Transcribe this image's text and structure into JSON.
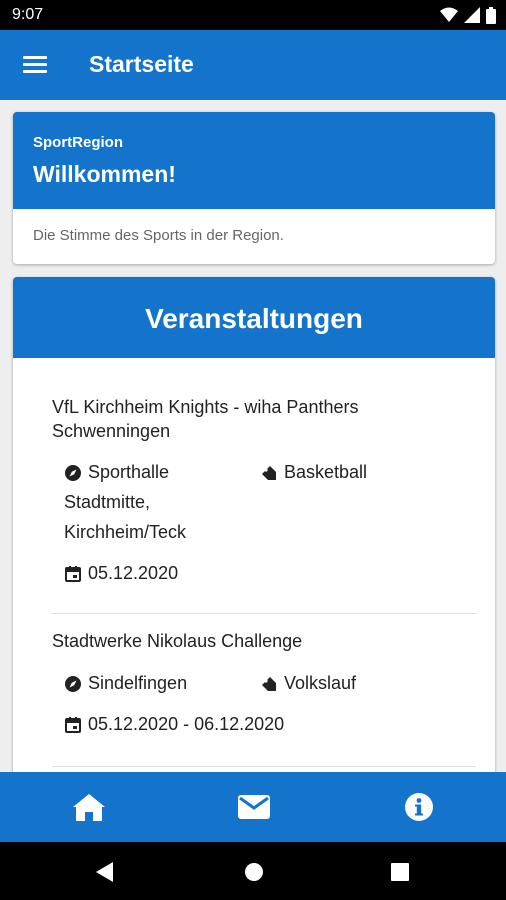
{
  "status_bar": {
    "time": "9:07"
  },
  "app_bar": {
    "title": "Startseite"
  },
  "welcome": {
    "overline": "SportRegion",
    "title": "Willkommen!",
    "subtitle": "Die Stimme des Sports in der Region."
  },
  "events": {
    "title": "Veranstaltungen",
    "items": [
      {
        "name_line1": "VfL Kirchheim Knights - wiha Panthers",
        "name_line2": "Schwenningen",
        "location_line1": "Sporthalle",
        "location_line2": "Stadtmitte,",
        "location_line3": "Kirchheim/Teck",
        "sport": "Basketball",
        "date": "05.12.2020"
      },
      {
        "name_line1": "Stadtwerke Nikolaus Challenge",
        "location_line1": "Sindelfingen",
        "sport": "Volkslauf",
        "date": "05.12.2020 - 06.12.2020"
      }
    ]
  },
  "icons": {
    "location": "compass-icon",
    "sport": "tag-icon",
    "date": "calendar-icon",
    "nav_home": "home-icon",
    "nav_mail": "mail-icon",
    "nav_info": "info-icon"
  },
  "colors": {
    "primary": "#1474cc",
    "system_bar": "#000000",
    "background": "#eeeeee"
  }
}
